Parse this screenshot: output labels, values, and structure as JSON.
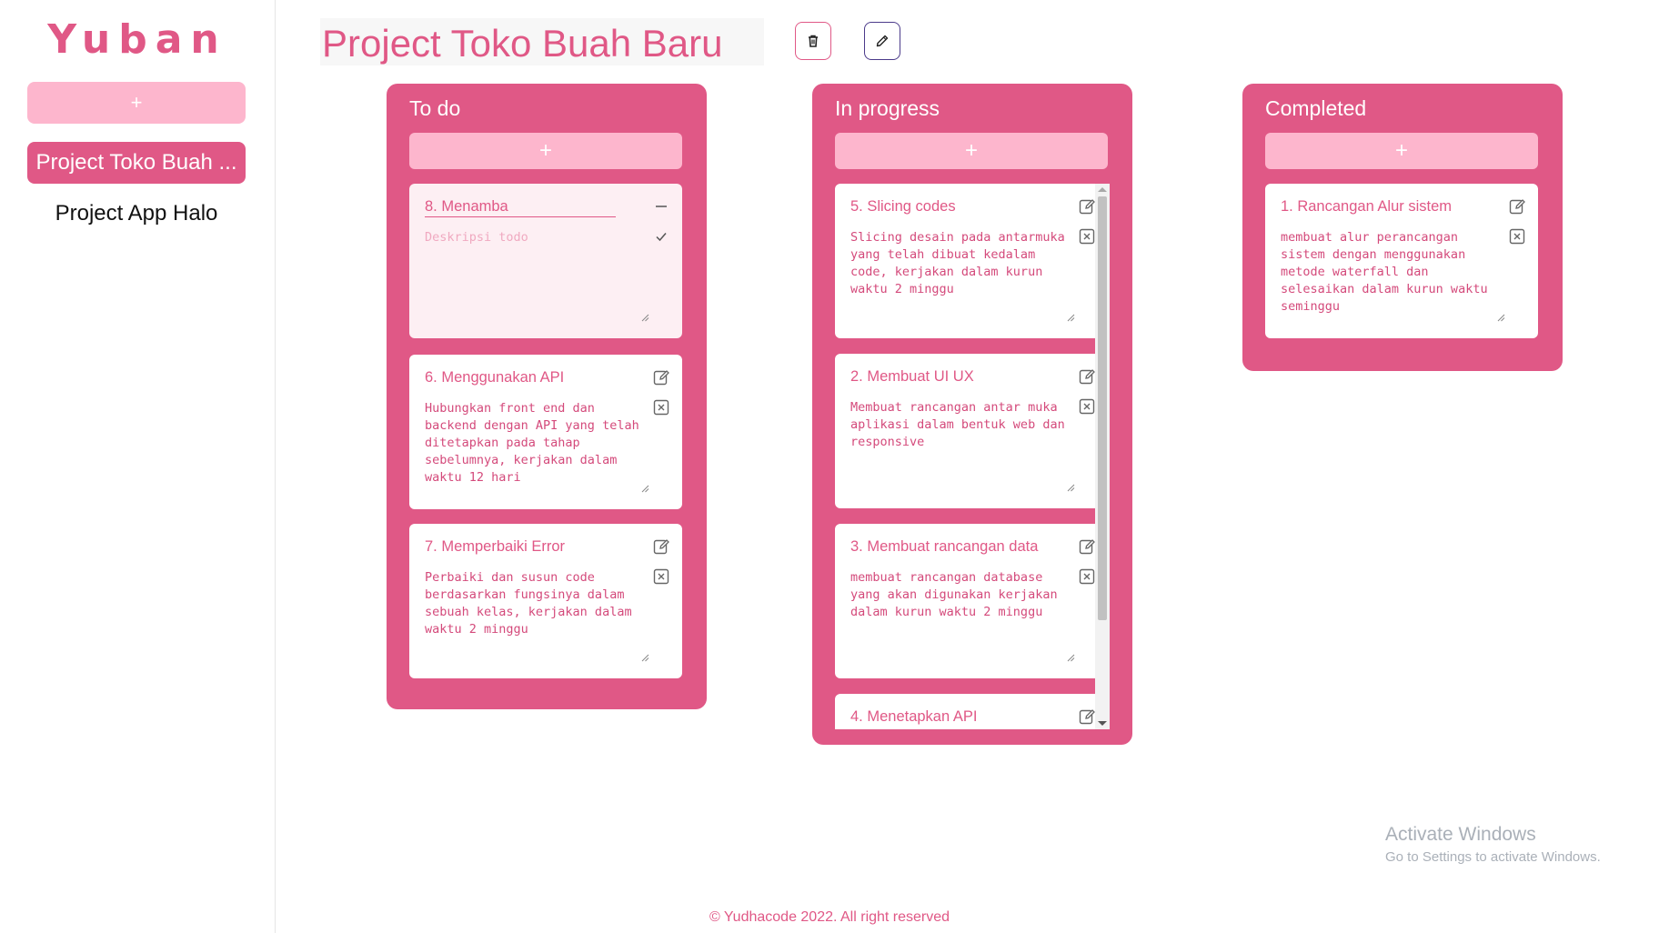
{
  "sidebar": {
    "brand": "Yuban",
    "add_label": "+",
    "projects": [
      {
        "label": "Project Toko Buah ...",
        "active": true
      },
      {
        "label": "Project App Halo",
        "active": false
      }
    ]
  },
  "header": {
    "title": "Project Toko Buah Baru"
  },
  "columns": [
    {
      "title": "To do",
      "add_label": "+",
      "cards": [
        {
          "title": "8. Menamba",
          "description": "",
          "description_placeholder": "Deskripsi todo",
          "editing": true
        },
        {
          "title": "6. Menggunakan API",
          "description": "Hubungkan front end dan backend dengan API yang telah ditetapkan pada tahap sebelumnya, kerjakan dalam waktu 12 hari"
        },
        {
          "title": "7. Memperbaiki Error",
          "description": "Perbaiki dan susun code berdasarkan fungsinya dalam sebuah kelas, kerjakan dalam waktu 2 minggu"
        }
      ]
    },
    {
      "title": "In progress",
      "add_label": "+",
      "cards": [
        {
          "title": "5. Slicing codes",
          "description": "Slicing desain pada antarmuka yang telah dibuat kedalam code, kerjakan dalam kurun waktu 2 minggu"
        },
        {
          "title": "2. Membuat UI UX",
          "description": "Membuat rancangan antar muka aplikasi dalam bentuk web dan responsive"
        },
        {
          "title": "3. Membuat rancangan data",
          "description": "membuat rancangan database yang akan digunakan kerjakan dalam kurun waktu 2 minggu"
        },
        {
          "title": "4. Menetapkan API",
          "description": ""
        }
      ]
    },
    {
      "title": "Completed",
      "add_label": "+",
      "cards": [
        {
          "title": "1. Rancangan Alur sistem",
          "description": "membuat alur perancangan sistem dengan menggunakan metode waterfall dan selesaikan dalam kurun waktu seminggu"
        }
      ]
    }
  ],
  "watermark": {
    "line1": "Activate Windows",
    "line2": "Go to Settings to activate Windows."
  },
  "footer": {
    "text": "© Yudhacode 2022. All right reserved"
  },
  "colors": {
    "accent": "#e05886",
    "accent_light": "#fdb6cd",
    "card_bg": "#ffffff",
    "edit_button_border": "#4b3a8a"
  }
}
